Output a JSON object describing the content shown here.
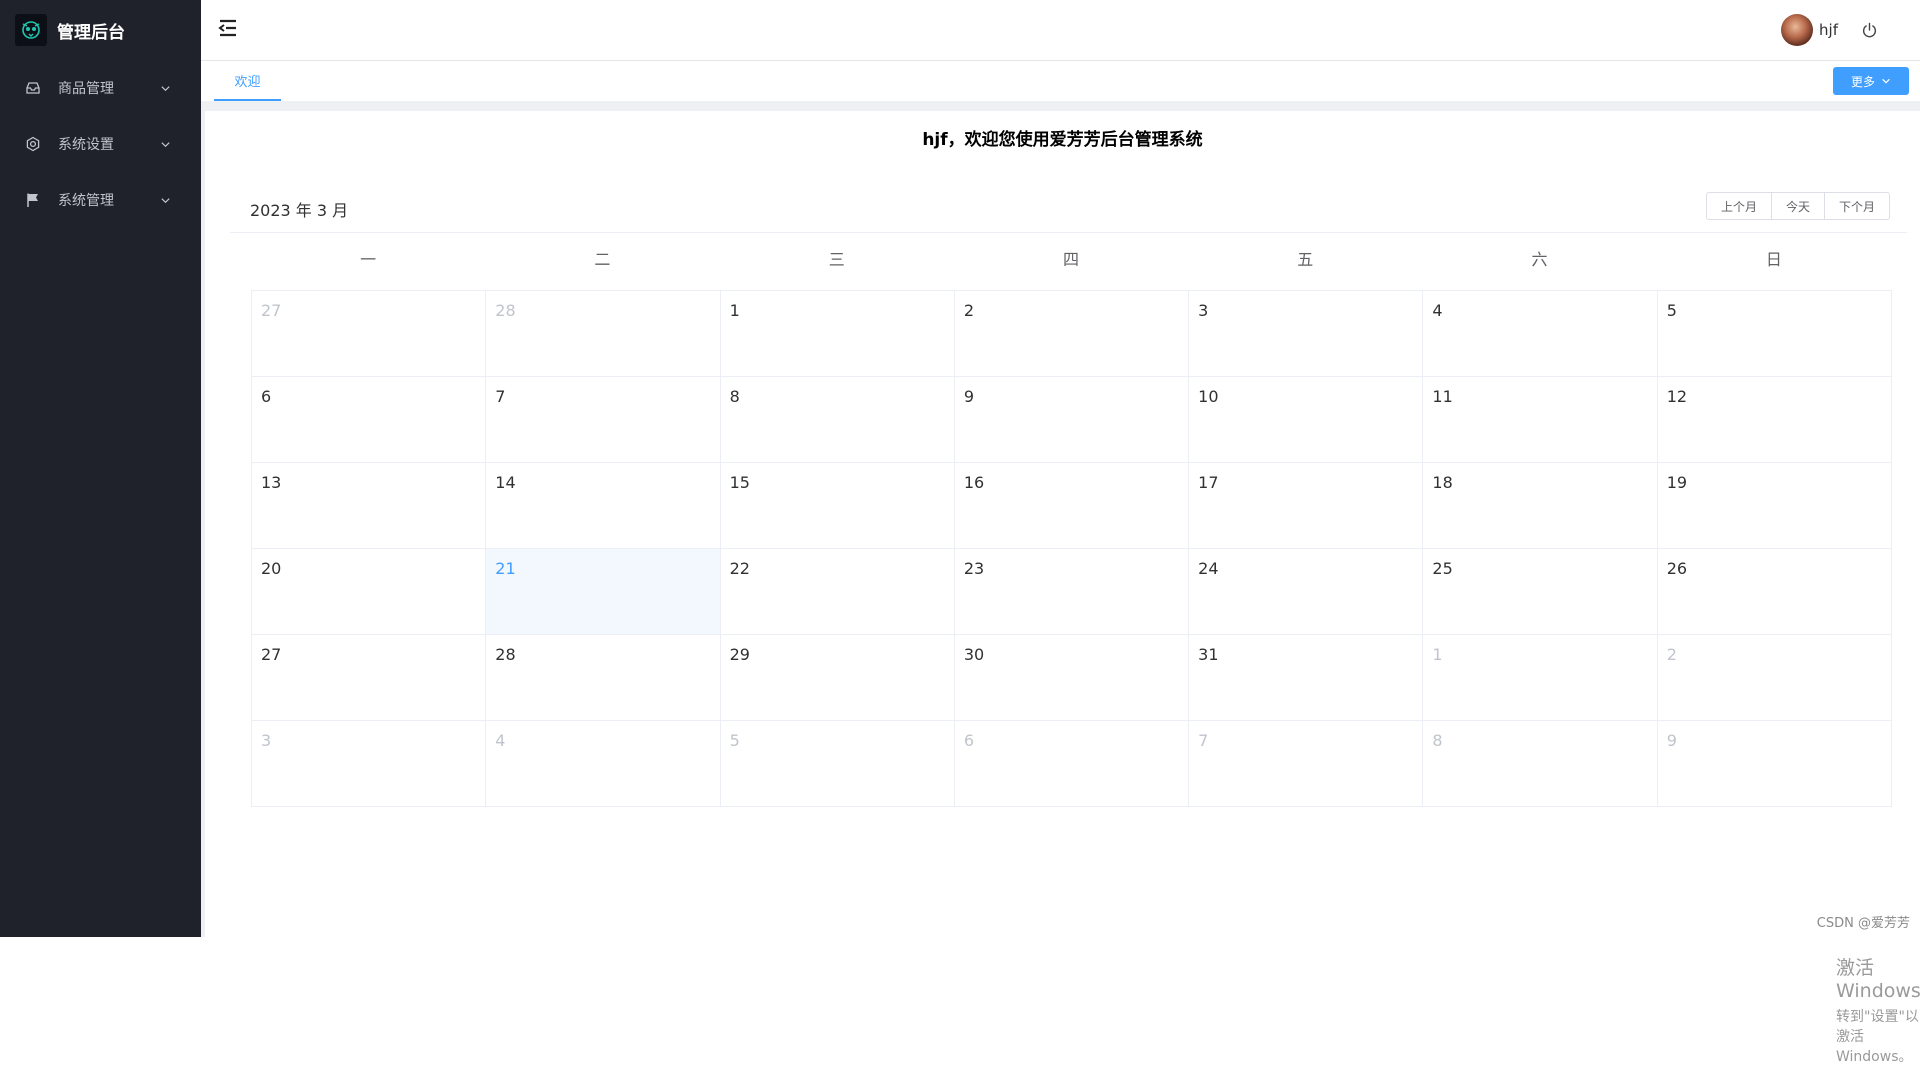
{
  "brand": {
    "title": "管理后台",
    "logo_icon": "owl-logo-icon"
  },
  "sidebar": {
    "items": [
      {
        "label": "商品管理",
        "icon": "inbox-icon"
      },
      {
        "label": "系统设置",
        "icon": "gear-icon"
      },
      {
        "label": "系统管理",
        "icon": "flag-icon"
      }
    ]
  },
  "header": {
    "user_name": "hjf"
  },
  "tabs": {
    "active_label": "欢迎",
    "more_label": "更多"
  },
  "main": {
    "welcome_text": "hjf，欢迎您使用爱芳芳后台管理系统"
  },
  "calendar": {
    "title": "2023 年 3 月",
    "buttons": {
      "prev": "上个月",
      "today": "今天",
      "next": "下个月"
    },
    "weekdays": [
      "一",
      "二",
      "三",
      "四",
      "五",
      "六",
      "日"
    ],
    "today_day": "21",
    "weeks": [
      [
        {
          "d": "27",
          "o": true
        },
        {
          "d": "28",
          "o": true
        },
        {
          "d": "1"
        },
        {
          "d": "2"
        },
        {
          "d": "3"
        },
        {
          "d": "4"
        },
        {
          "d": "5"
        }
      ],
      [
        {
          "d": "6"
        },
        {
          "d": "7"
        },
        {
          "d": "8"
        },
        {
          "d": "9"
        },
        {
          "d": "10"
        },
        {
          "d": "11"
        },
        {
          "d": "12"
        }
      ],
      [
        {
          "d": "13"
        },
        {
          "d": "14"
        },
        {
          "d": "15"
        },
        {
          "d": "16"
        },
        {
          "d": "17"
        },
        {
          "d": "18"
        },
        {
          "d": "19"
        }
      ],
      [
        {
          "d": "20"
        },
        {
          "d": "21",
          "t": true
        },
        {
          "d": "22"
        },
        {
          "d": "23"
        },
        {
          "d": "24"
        },
        {
          "d": "25"
        },
        {
          "d": "26"
        }
      ],
      [
        {
          "d": "27"
        },
        {
          "d": "28"
        },
        {
          "d": "29"
        },
        {
          "d": "30"
        },
        {
          "d": "31"
        },
        {
          "d": "1",
          "o": true
        },
        {
          "d": "2",
          "o": true
        }
      ],
      [
        {
          "d": "3",
          "o": true
        },
        {
          "d": "4",
          "o": true
        },
        {
          "d": "5",
          "o": true
        },
        {
          "d": "6",
          "o": true
        },
        {
          "d": "7",
          "o": true
        },
        {
          "d": "8",
          "o": true
        },
        {
          "d": "9",
          "o": true
        }
      ]
    ]
  },
  "watermark": {
    "line1": "激活 Windows",
    "line2": "转到\"设置\"以激活 Windows。"
  },
  "credit": "CSDN @爱芳芳",
  "colors": {
    "sidebar_bg": "#1f222a",
    "accent": "#409eff",
    "today_bg": "#f2f8fe"
  }
}
